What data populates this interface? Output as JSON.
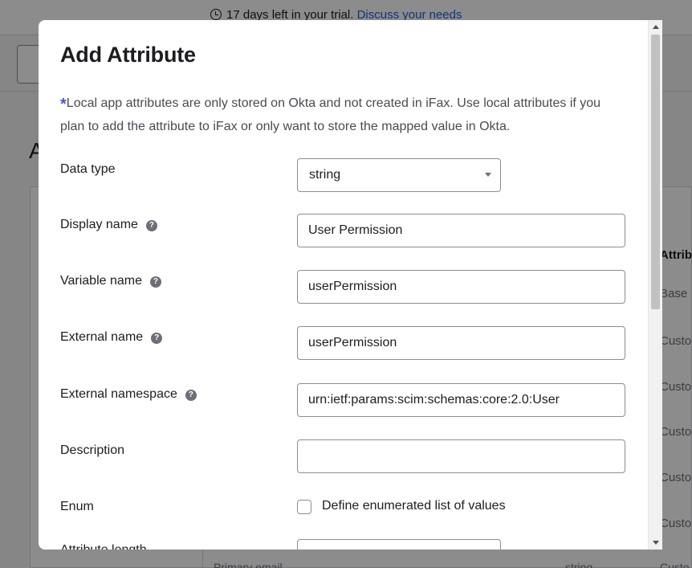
{
  "background": {
    "trial_text": "17 days left in your trial.",
    "trial_link": "Discuss your needs",
    "heading_fragment": "A",
    "table_header_fragment": "Attribu",
    "table_cells": [
      "Base",
      "Custo",
      "Custo",
      "Custo",
      "Custo",
      "Custo"
    ],
    "bottom_row": {
      "name": "Primary email",
      "type": "string",
      "source": "Custo"
    }
  },
  "modal": {
    "title": "Add Attribute",
    "notice_asterisk": "*",
    "notice_text": "Local app attributes are only stored on Okta and not created in iFax. Use local attributes if you plan to add the attribute to iFax or only want to store the mapped value in Okta.",
    "fields": {
      "data_type": {
        "label": "Data type",
        "value": "string"
      },
      "display_name": {
        "label": "Display name",
        "value": "User Permission"
      },
      "variable_name": {
        "label": "Variable name",
        "value": "userPermission"
      },
      "external_name": {
        "label": "External name",
        "value": "userPermission"
      },
      "external_namespace": {
        "label": "External namespace",
        "value": "urn:ietf:params:scim:schemas:core:2.0:User"
      },
      "description": {
        "label": "Description",
        "value": ""
      },
      "enum": {
        "label": "Enum",
        "checkbox_label": "Define enumerated list of values",
        "checked": false
      },
      "attribute_length": {
        "label": "Attribute length"
      }
    },
    "help_glyph": "?"
  },
  "colors": {
    "accent_blue": "#1662dd",
    "asterisk": "#4858d6",
    "overlay": "rgba(0,0,0,0.45)"
  }
}
